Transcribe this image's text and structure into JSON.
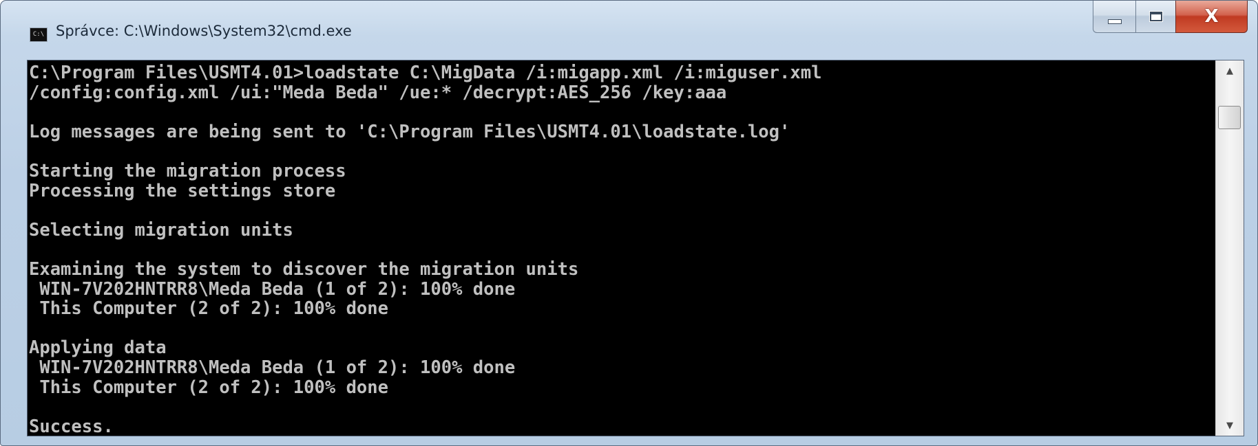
{
  "window": {
    "title": "Správce: C:\\Windows\\System32\\cmd.exe",
    "icon": "cmd-console-icon",
    "icon_glyph": "C:\\",
    "buttons": {
      "minimize_icon": "minimize-icon",
      "maximize_icon": "maximize-icon",
      "close_icon": "close-icon",
      "close_glyph": "X"
    },
    "close_color": "#c03a22"
  },
  "console": {
    "background": "#000000",
    "foreground": "#c0c0c0",
    "lines": [
      "C:\\Program Files\\USMT4.01>loadstate C:\\MigData /i:migapp.xml /i:miguser.xml",
      "/config:config.xml /ui:\"Meda Beda\" /ue:* /decrypt:AES_256 /key:aaa",
      "",
      "Log messages are being sent to 'C:\\Program Files\\USMT4.01\\loadstate.log'",
      "",
      "Starting the migration process",
      "Processing the settings store",
      "",
      "Selecting migration units",
      "",
      "Examining the system to discover the migration units",
      " WIN-7V202HNTRR8\\Meda Beda (1 of 2): 100% done",
      " This Computer (2 of 2): 100% done",
      "",
      "Applying data",
      " WIN-7V202HNTRR8\\Meda Beda (1 of 2): 100% done",
      " This Computer (2 of 2): 100% done",
      "",
      "Success."
    ]
  },
  "scrollbar": {
    "up_glyph": "▲",
    "down_glyph": "▼"
  }
}
